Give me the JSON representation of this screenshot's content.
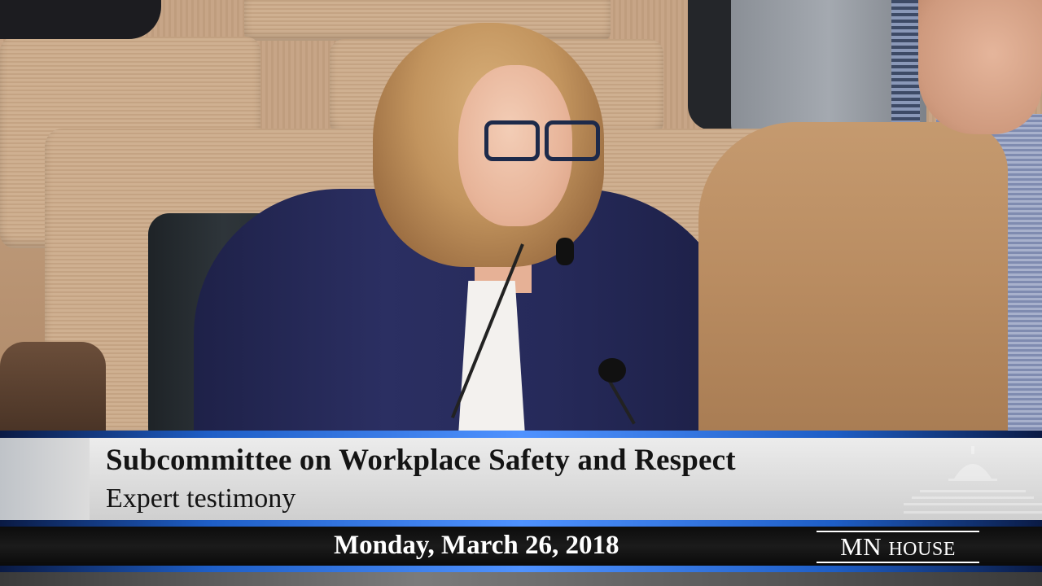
{
  "lower_third": {
    "title": "Subcommittee on Workplace Safety and Respect",
    "subtitle": "Expert testimony",
    "date": "Monday, March 26, 2018",
    "logo": {
      "main": "MN",
      "rest": "House"
    }
  },
  "colors": {
    "accent_blue": "#1e5ec6",
    "panel_gray": "#dcdcdc",
    "bar_black": "#111111"
  }
}
